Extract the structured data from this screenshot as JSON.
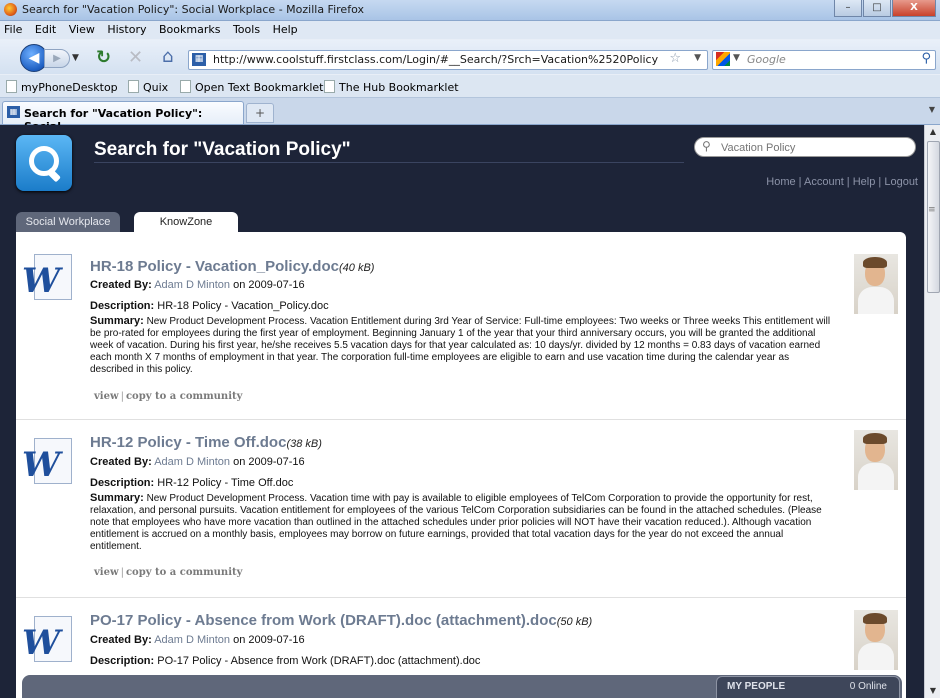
{
  "window": {
    "title": "Search for \"Vacation Policy\": Social Workplace - Mozilla Firefox",
    "controls": {
      "minimize": "–",
      "maximize": "□",
      "close": "X"
    }
  },
  "menu": [
    "File",
    "Edit",
    "View",
    "History",
    "Bookmarks",
    "Tools",
    "Help"
  ],
  "toolbar": {
    "url": "http://www.coolstuff.firstclass.com/Login/#__Search/?Srch=Vacation%2520Policy",
    "search_engine_placeholder": "Google"
  },
  "bookmarks": [
    "myPhoneDesktop",
    "Quix",
    "Open Text Bookmarklet",
    "The Hub Bookmarklet"
  ],
  "tab": {
    "label": "Search for \"Vacation Policy\": Social ...",
    "new_tab": "+"
  },
  "site": {
    "page_title": "Search for \"Vacation Policy\"",
    "search_placeholder": "Vacation Policy",
    "top_links": [
      "Home",
      "Account",
      "Help",
      "Logout"
    ],
    "tabs": [
      "Social Workplace",
      "KnowZone"
    ],
    "active_tab": "KnowZone"
  },
  "results": [
    {
      "title": "HR-18 Policy - Vacation_Policy.doc",
      "size": "(40 kB)",
      "created_by_label": "Created By:",
      "author": "Adam D Minton",
      "date": "on 2009-07-16",
      "description_label": "Description:",
      "description": "HR-18 Policy - Vacation_Policy.doc",
      "summary_label": "Summary:",
      "summary": "New Product Development Process. Vacation Entitlement during 3rd Year of Service: Full-time employees: Two weeks or Three weeks This entitlement will be pro-rated for employees during the first year of employment. Beginning January 1 of the year that your third anniversary occurs, you will be granted the additional week of vacation. During his first year, he/she receives 5.5 vacation days for that year calculated as: 10 days/yr. divided by 12 months = 0.83 days of vacation earned each month X 7 months of employment in that year. The corporation full-time employees are eligible to earn and use vacation time during the calendar year as described in this policy.",
      "actions": [
        "view",
        "copy to a community"
      ]
    },
    {
      "title": "HR-12 Policy - Time Off.doc",
      "size": "(38 kB)",
      "created_by_label": "Created By:",
      "author": "Adam D Minton",
      "date": "on 2009-07-16",
      "description_label": "Description:",
      "description": "HR-12 Policy - Time Off.doc",
      "summary_label": "Summary:",
      "summary": "New Product Development Process. Vacation time with pay is available to eligible employees of TelCom Corporation to provide the opportunity for rest, relaxation, and personal pursuits. Vacation entitlement for employees of the various TelCom Corporation subsidiaries can be found in the attached schedules. (Please note that employees who have more vacation than outlined in the attached schedules under prior policies will NOT have their vacation reduced.). Although vacation entitlement is accrued on a monthly basis, employees may borrow on future earnings, provided that total vacation days for the year do not exceed the annual entitlement.",
      "actions": [
        "view",
        "copy to a community"
      ]
    },
    {
      "title": "PO-17 Policy - Absence from Work (DRAFT).doc (attachment).doc",
      "size": "(50 kB)",
      "created_by_label": "Created By:",
      "author": "Adam D Minton",
      "date": "on 2009-07-16",
      "description_label": "Description:",
      "description": "PO-17 Policy - Absence from Work (DRAFT).doc (attachment).doc"
    }
  ],
  "my_people": {
    "label": "MY PEOPLE",
    "online": "0 Online"
  }
}
